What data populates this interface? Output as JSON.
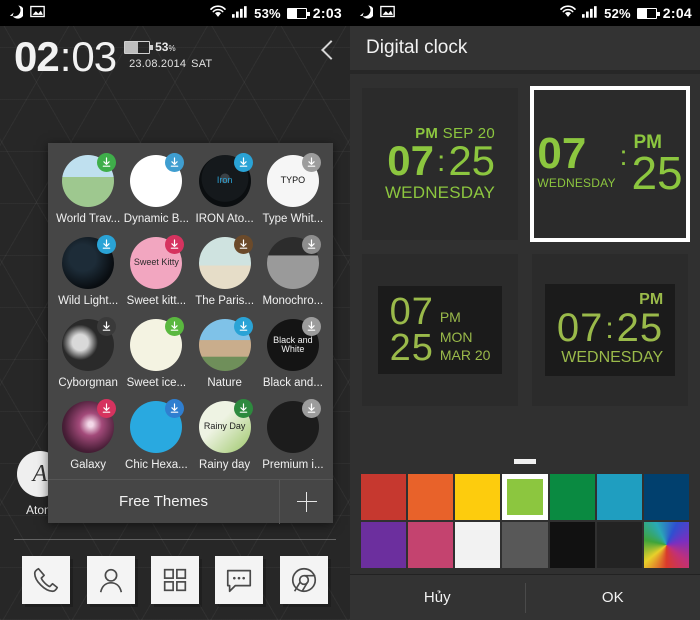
{
  "left": {
    "statusbar": {
      "icons": [
        "moon-icon",
        "gallery-icon"
      ],
      "wifi": "wifi-icon",
      "signal": "signal-icon",
      "battery_pct": "53%",
      "battery_level": 53,
      "time": "2:03"
    },
    "lockscreen": {
      "hour": "02",
      "separator": ":",
      "minute": "03",
      "battery_pct": "53",
      "battery_pct_unit": "%",
      "battery_level": 53,
      "date": "23.08.2014",
      "weekday": "SAT",
      "back_chevron": "chevron-left-icon"
    },
    "background_app": {
      "label": "Atom",
      "glyph": "A"
    },
    "theme_panel": {
      "footer_label": "Free Themes",
      "add_icon": "plus-icon",
      "themes": [
        {
          "name": "World Trav...",
          "badge_color": "#3fae4a",
          "icon": "world-travel-thumb",
          "bg": "linear-gradient(180deg,#bfe0ef 0 42%,#9ec88f 42% 100%)",
          "fg": "#ffffff",
          "glyph": ""
        },
        {
          "name": "Dynamic B...",
          "badge_color": "#3f9ed0",
          "icon": "dynamic-thumb",
          "bg": "#ffffff",
          "fg": "#2f8fce",
          "glyph": ""
        },
        {
          "name": "IRON Ato...",
          "badge_color": "#2aa3d6",
          "icon": "iron-atom-thumb",
          "bg": "radial-gradient(circle at 50% 45%, #3a4146 0 12%, #15191c 13% 60%, #0b0e10 61% 100%)",
          "fg": "#2aa3d6",
          "glyph": "Iron"
        },
        {
          "name": "Type Whit...",
          "badge_color": "#9c9c9c",
          "icon": "typography-thumb",
          "bg": "#f6f6f6",
          "fg": "#111111",
          "glyph": "TYPO"
        },
        {
          "name": "Wild Light...",
          "badge_color": "#2aa3d6",
          "icon": "wild-light-thumb",
          "bg": "radial-gradient(circle at 40% 40%, #1d2c38 0 30%, #090d11 70% 100%)",
          "fg": "#39b6e0",
          "glyph": ""
        },
        {
          "name": "Sweet kitt...",
          "badge_color": "#d6335f",
          "icon": "sweet-kitty-thumb",
          "bg": "#f2a6c0",
          "fg": "#2b2b2b",
          "glyph": "Sweet Kitty"
        },
        {
          "name": "The Paris...",
          "badge_color": "#6b4a2a",
          "icon": "paris-thumb",
          "bg": "linear-gradient(180deg,#cfe3e0 0 55%,#e6ddc8 55% 100%)",
          "fg": "#7d6a52",
          "glyph": ""
        },
        {
          "name": "Monochro...",
          "badge_color": "#8e8e8e",
          "icon": "monochrome-thumb",
          "bg": "linear-gradient(180deg,#2c2c2c 0 35%,#9a9a9a 36% 100%)",
          "fg": "#e8e8e8",
          "glyph": ""
        },
        {
          "name": "Cyborgman",
          "badge_color": "#3a3a3a",
          "icon": "cyborgman-thumb",
          "bg": "radial-gradient(circle at 35% 45%, #d9d9d9 0 18%, #2a2a2a 40% 100%)",
          "fg": "#ffffff",
          "glyph": ""
        },
        {
          "name": "Sweet ice...",
          "badge_color": "#5ab83f",
          "icon": "sweet-ice-thumb",
          "bg": "#f4f3e2",
          "fg": "#8aa84b",
          "glyph": ""
        },
        {
          "name": "Nature",
          "badge_color": "#2aa3d6",
          "icon": "nature-thumb",
          "bg": "linear-gradient(180deg,#7fc2e8 0 40%,#c9ad8c 41% 72%,#6f8f5a 73% 100%)",
          "fg": "#ffffff",
          "glyph": ""
        },
        {
          "name": "Black and...",
          "badge_color": "#9c9c9c",
          "icon": "black-and-white-thumb",
          "bg": "#141414",
          "fg": "#f2f2f2",
          "glyph": "Black and White"
        },
        {
          "name": "Galaxy",
          "badge_color": "#d6335f",
          "icon": "galaxy-thumb",
          "bg": "radial-gradient(circle at 55% 45%, #f3d8e8 0 6%, #a34a7a 28%, #4a1f38 65%, #1a0d16 100%)",
          "fg": "#ffffff",
          "glyph": ""
        },
        {
          "name": "Chic Hexa...",
          "badge_color": "#2f7fd0",
          "icon": "chic-hexagon-thumb",
          "bg": "#29a9e0",
          "fg": "#bfe7f7",
          "glyph": ""
        },
        {
          "name": "Rainy day",
          "badge_color": "#2d8a3e",
          "icon": "rainy-day-thumb",
          "bg": "linear-gradient(135deg,#eef3e3 0 40%,#9dc76a 100%)",
          "fg": "#1e1e1e",
          "glyph": "Rainy Day"
        },
        {
          "name": "Premium i...",
          "badge_color": "#9c9c9c",
          "icon": "premium-icons-thumb",
          "bg": "#1c1c1c",
          "fg": "#e8e8e8",
          "glyph": ""
        }
      ]
    },
    "dock": [
      {
        "name": "phone-icon"
      },
      {
        "name": "contacts-icon"
      },
      {
        "name": "app-drawer-icon"
      },
      {
        "name": "messages-icon"
      },
      {
        "name": "browser-icon"
      }
    ]
  },
  "right": {
    "statusbar": {
      "icons": [
        "moon-icon",
        "gallery-icon"
      ],
      "wifi": "wifi-icon",
      "signal": "signal-icon",
      "battery_pct": "52%",
      "battery_level": 52,
      "time": "2:04"
    },
    "title": "Digital clock",
    "accent_color": "#8cc63f",
    "widgets": [
      {
        "id": "style-1",
        "selected": false,
        "ampm": "PM",
        "date": "SEP 20",
        "hour": "07",
        "separator": ":",
        "minute": "25",
        "weekday": "WEDNESDAY"
      },
      {
        "id": "style-2",
        "selected": true,
        "hour": "07",
        "separator": ":",
        "weekday": "WEDNESDAY",
        "ampm": "PM",
        "minute": "25"
      },
      {
        "id": "style-3",
        "selected": false,
        "hour": "07",
        "ampm": "PM",
        "minute": "25",
        "weekday": "MON",
        "date": "MAR 20"
      },
      {
        "id": "style-4",
        "selected": false,
        "ampm": "PM",
        "hour": "07",
        "separator": ":",
        "minute": "25",
        "weekday": "WEDNESDAY"
      }
    ],
    "palette": {
      "handle": "drag-handle",
      "swatches": [
        {
          "name": "red",
          "color": "#c6382f",
          "selected": false
        },
        {
          "name": "orange",
          "color": "#e8622a",
          "selected": false
        },
        {
          "name": "yellow",
          "color": "#fdcc0d",
          "selected": false
        },
        {
          "name": "green-light",
          "color": "#8cc63f",
          "selected": true
        },
        {
          "name": "green-dark",
          "color": "#0a8a41",
          "selected": false
        },
        {
          "name": "teal",
          "color": "#1f9ec0",
          "selected": false
        },
        {
          "name": "blue-dark",
          "color": "#01406e",
          "selected": false
        },
        {
          "name": "purple",
          "color": "#6c2f9e",
          "selected": false
        },
        {
          "name": "pink",
          "color": "#c4436f",
          "selected": false
        },
        {
          "name": "white",
          "color": "#f2f2f2",
          "selected": false
        },
        {
          "name": "grey",
          "color": "#585858",
          "selected": false
        },
        {
          "name": "black",
          "color": "#111111",
          "selected": false
        },
        {
          "name": "near-black",
          "color": "#232323",
          "selected": false
        },
        {
          "name": "color-wheel",
          "color": "wheel",
          "selected": false
        }
      ]
    },
    "buttons": {
      "cancel": "Hủy",
      "ok": "OK"
    }
  }
}
